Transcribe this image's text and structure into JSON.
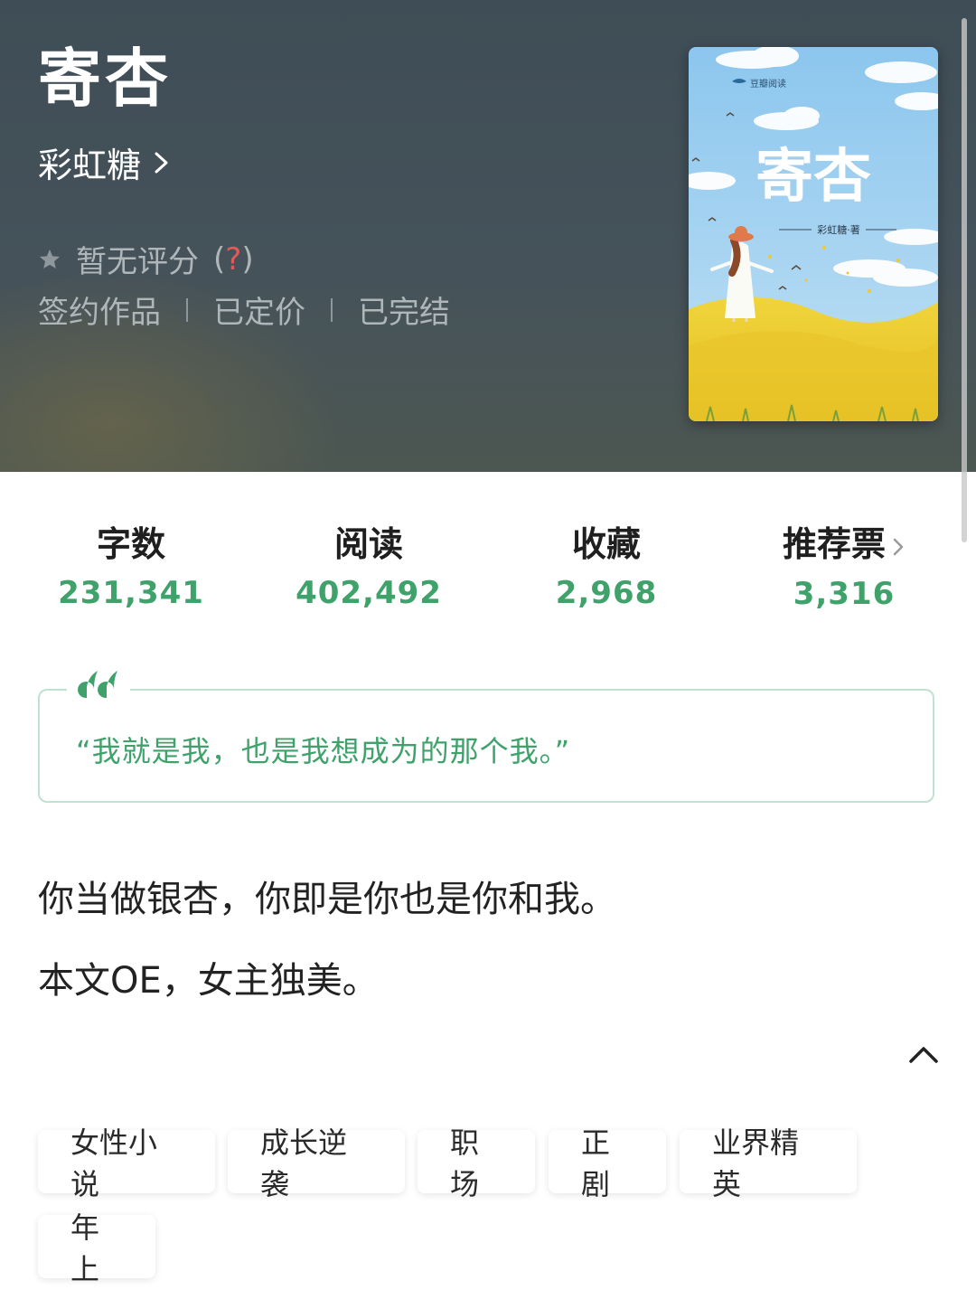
{
  "header": {
    "title": "寄杏",
    "author": "彩虹糖",
    "rating_text": "暂无评分",
    "rating_help_open": "(",
    "rating_help_q": "?",
    "rating_help_close": ")",
    "meta": [
      "签约作品",
      "已定价",
      "已完结"
    ]
  },
  "cover": {
    "publisher": "豆瓣阅读",
    "title": "寄杏",
    "byline": "彩虹糖·著"
  },
  "stats": [
    {
      "label": "字数",
      "value": "231,341"
    },
    {
      "label": "阅读",
      "value": "402,492"
    },
    {
      "label": "收藏",
      "value": "2,968"
    },
    {
      "label": "推荐票",
      "value": "3,316"
    }
  ],
  "quote": {
    "text": "“我就是我，也是我想成为的那个我。”"
  },
  "description": {
    "line1": "你当做银杏，你即是你也是你和我。",
    "line2": "本文OE，女主独美。"
  },
  "tags": [
    "女性小说",
    "成长逆袭",
    "职场",
    "正剧",
    "业界精英",
    "年上"
  ],
  "colors": {
    "accent_green": "#3fa26b",
    "header_bg": "#44515a",
    "quote_border": "#bfe2d1"
  },
  "icons": {
    "author_chevron": "chevron-right-icon",
    "rating": "star-icon",
    "stats_chevron": "chevron-right-icon",
    "quote": "quote-mark-icon",
    "collapse": "chevron-up-icon"
  }
}
